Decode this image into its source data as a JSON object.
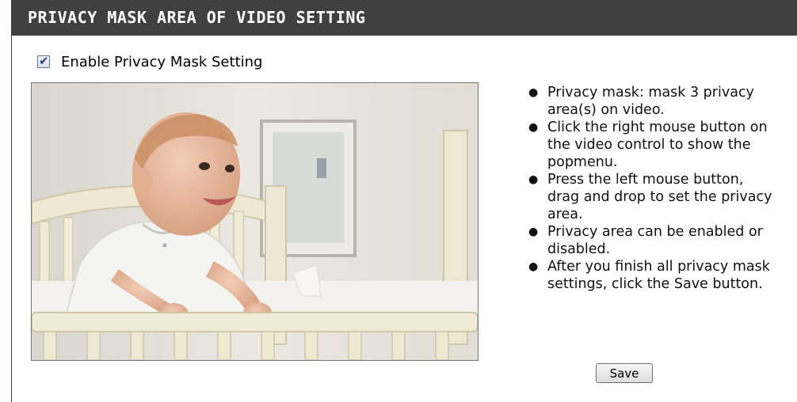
{
  "header": {
    "title": "PRIVACY MASK AREA OF VIDEO SETTING"
  },
  "enable_privacy_mask": {
    "label": "Enable Privacy Mask Setting",
    "checked": true
  },
  "video_preview": {
    "icon": "baby-in-crib-video-frame"
  },
  "instructions": [
    "Privacy mask: mask 3 privacy area(s) on video.",
    "Click the right mouse button on the video control to show the popmenu.",
    "Press the left mouse button, drag and drop to set the privacy area.",
    "Privacy area can be enabled or disabled.",
    "After you finish all privacy mask settings, click the Save button."
  ],
  "buttons": {
    "save_label": "Save"
  },
  "colors": {
    "header_bg": "#404040",
    "header_text": "#ffffff",
    "checkbox_check": "#21408a"
  }
}
